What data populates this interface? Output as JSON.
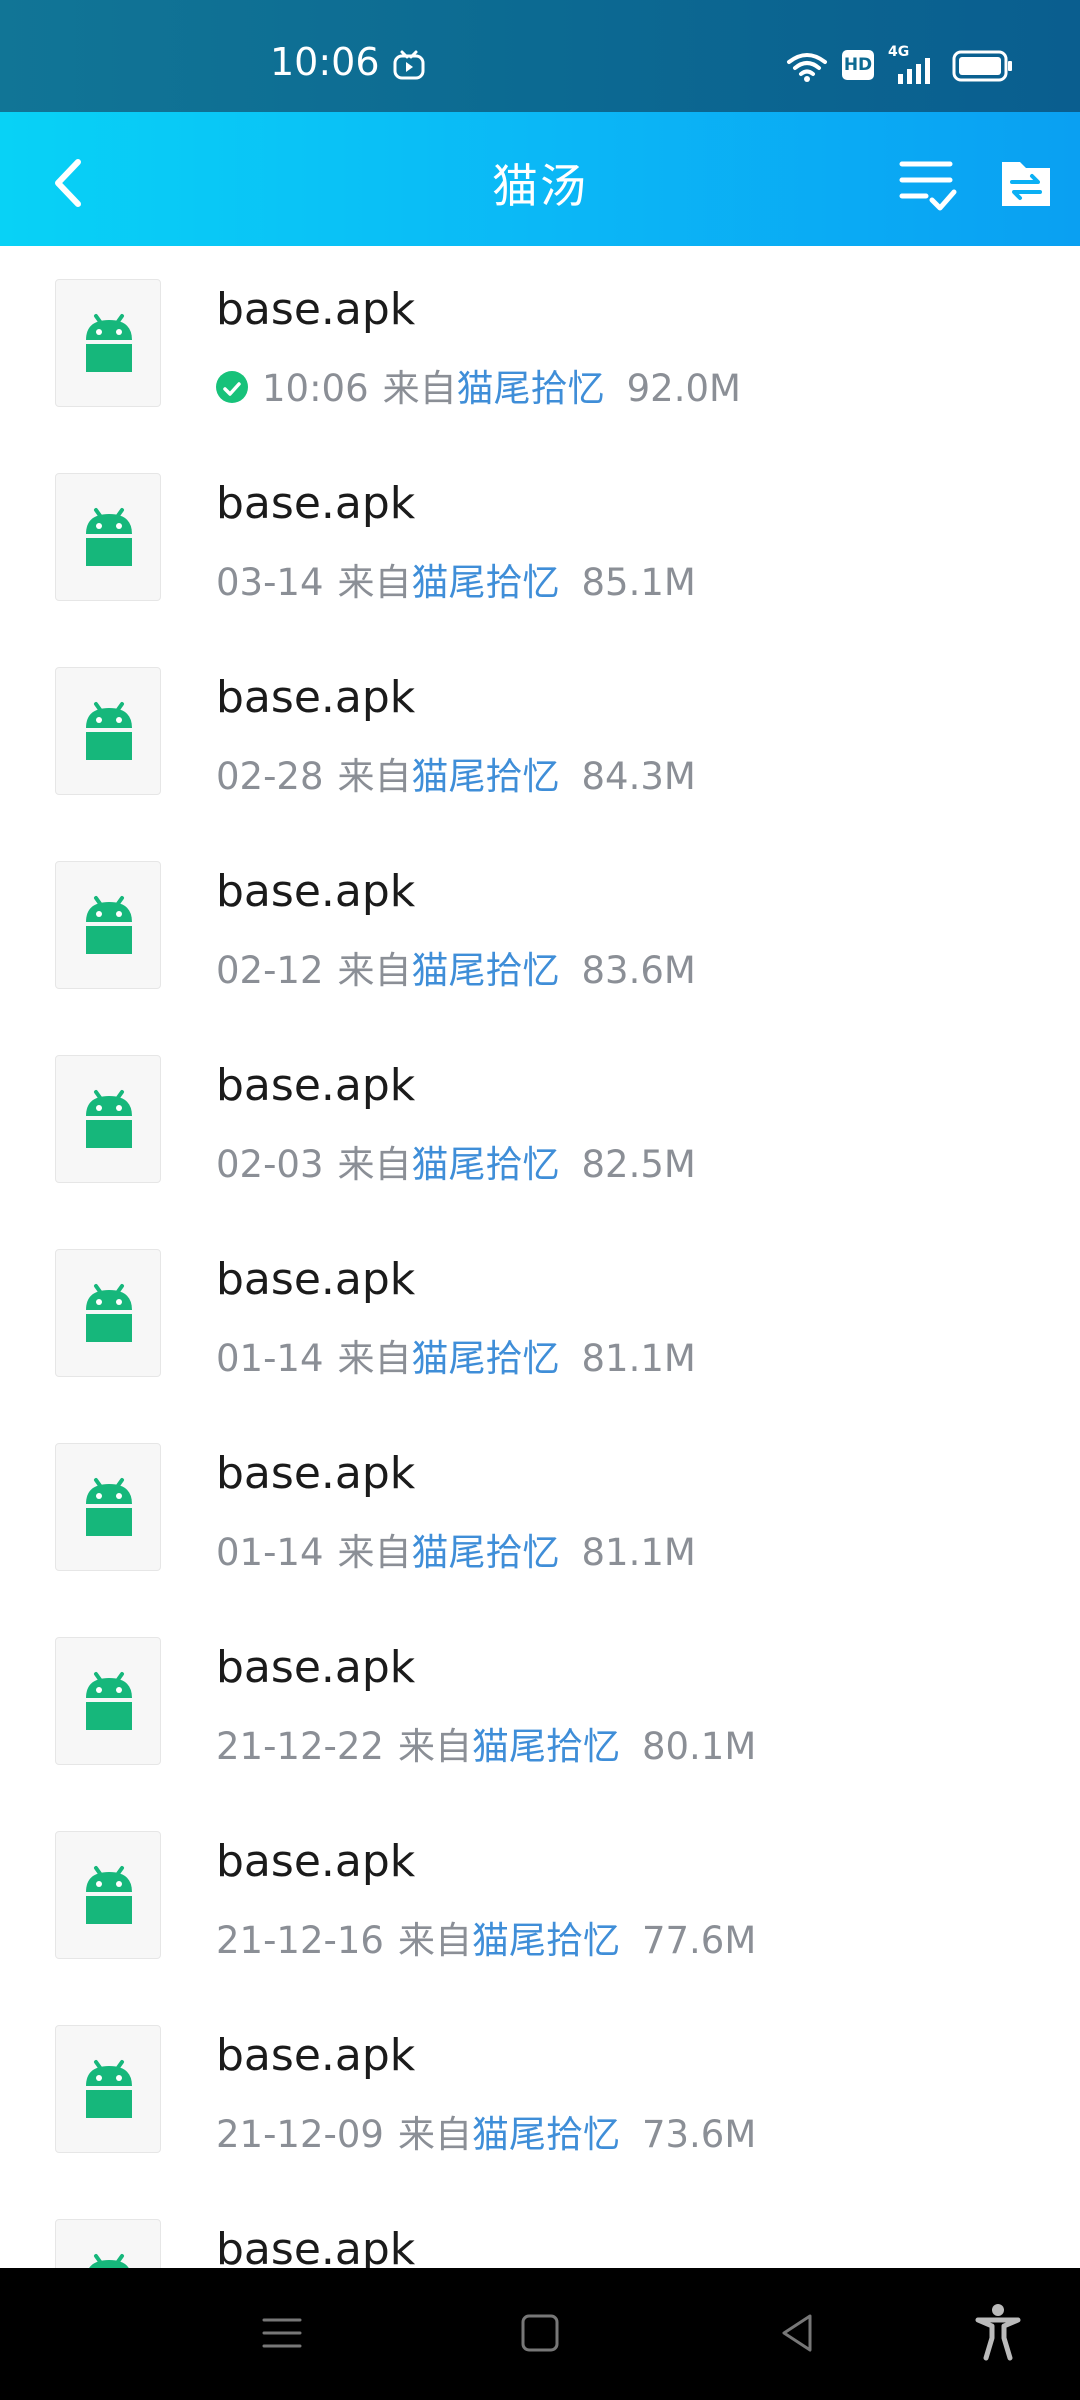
{
  "status_bar": {
    "time": "10:06",
    "icons": [
      "video-app-icon",
      "wifi-icon",
      "hd-icon",
      "signal-4g-icon",
      "battery-icon"
    ],
    "hd_label": "HD",
    "network_label": "4G"
  },
  "toolbar": {
    "title": "猫汤",
    "back_icon": "chevron-left-icon",
    "select_icon": "checklist-icon",
    "folder_icon": "folder-transfer-icon"
  },
  "colors": {
    "toolbar_start": "#08d2f6",
    "toolbar_end": "#0aa0f2",
    "sender_link": "#3f8ed8",
    "android_green": "#16b77b",
    "done_check": "#17c27a"
  },
  "files": [
    {
      "name": "base.apk",
      "date": "10:06",
      "from": "来自",
      "sender": "猫尾拾忆",
      "size": "92.0M",
      "done": true
    },
    {
      "name": "base.apk",
      "date": "03-14",
      "from": "来自",
      "sender": "猫尾拾忆",
      "size": "85.1M",
      "done": false
    },
    {
      "name": "base.apk",
      "date": "02-28",
      "from": "来自",
      "sender": "猫尾拾忆",
      "size": "84.3M",
      "done": false
    },
    {
      "name": "base.apk",
      "date": "02-12",
      "from": "来自",
      "sender": "猫尾拾忆",
      "size": "83.6M",
      "done": false
    },
    {
      "name": "base.apk",
      "date": "02-03",
      "from": "来自",
      "sender": "猫尾拾忆",
      "size": "82.5M",
      "done": false
    },
    {
      "name": "base.apk",
      "date": "01-14",
      "from": "来自",
      "sender": "猫尾拾忆",
      "size": "81.1M",
      "done": false
    },
    {
      "name": "base.apk",
      "date": "01-14",
      "from": "来自",
      "sender": "猫尾拾忆",
      "size": "81.1M",
      "done": false
    },
    {
      "name": "base.apk",
      "date": "21-12-22",
      "from": "来自",
      "sender": "猫尾拾忆",
      "size": "80.1M",
      "done": false
    },
    {
      "name": "base.apk",
      "date": "21-12-16",
      "from": "来自",
      "sender": "猫尾拾忆",
      "size": "77.6M",
      "done": false
    },
    {
      "name": "base.apk",
      "date": "21-12-09",
      "from": "来自",
      "sender": "猫尾拾忆",
      "size": "73.6M",
      "done": false
    },
    {
      "name": "base.apk",
      "date": "",
      "from": "",
      "sender": "",
      "size": "",
      "done": false
    }
  ],
  "nav_bar": {
    "icons": [
      "menu-icon",
      "home-icon",
      "back-triangle-icon",
      "accessibility-icon"
    ]
  }
}
